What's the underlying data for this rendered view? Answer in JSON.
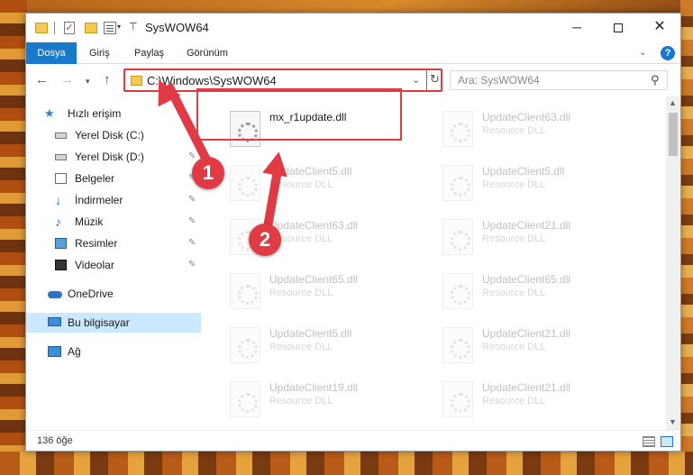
{
  "window": {
    "title": "SysWOW64",
    "min_label": "─",
    "close_label": "✕"
  },
  "quick_access": {
    "dropdown_glyph": "▾",
    "pin_glyph": "⊤"
  },
  "ribbon": {
    "tabs": [
      {
        "label": "Dosya"
      },
      {
        "label": "Giriş"
      },
      {
        "label": "Paylaş"
      },
      {
        "label": "Görünüm"
      }
    ],
    "expand_glyph": "⌄",
    "help_glyph": "?"
  },
  "nav": {
    "back_glyph": "←",
    "forward_glyph": "→",
    "recent_glyph": "▾",
    "up_glyph": "↑",
    "address": "C:\\Windows\\SysWOW64",
    "address_chevron": "⌄",
    "refresh_glyph": "↻",
    "search_placeholder": "Ara: SysWOW64",
    "search_glyph": "⚲"
  },
  "sidebar": {
    "items": [
      {
        "label": "Hızlı erişim",
        "icon": "star-icon"
      },
      {
        "label": "Yerel Disk (C:)",
        "icon": "drive-icon"
      },
      {
        "label": "Yerel Disk (D:)",
        "icon": "drive-icon",
        "pinned": true
      },
      {
        "label": "Belgeler",
        "icon": "documents-icon",
        "pinned": true
      },
      {
        "label": "İndirmeler",
        "icon": "download-icon",
        "pinned": true
      },
      {
        "label": "Müzik",
        "icon": "music-icon",
        "pinned": true
      },
      {
        "label": "Resimler",
        "icon": "pictures-icon",
        "pinned": true
      },
      {
        "label": "Videolar",
        "icon": "videos-icon",
        "pinned": true
      },
      {
        "label": "OneDrive",
        "icon": "cloud-icon"
      },
      {
        "label": "Bu bilgisayar",
        "icon": "computer-icon",
        "selected": true
      },
      {
        "label": "Ağ",
        "icon": "network-icon"
      }
    ],
    "pin_glyph": "✎"
  },
  "files": {
    "highlighted": {
      "name": "mx_r1update.dll",
      "desc": ""
    },
    "items": [
      {
        "name": "UpdateClient63.dll",
        "desc": "Resource DLL"
      },
      {
        "name": "UpdateClient5.dll",
        "desc": "Resource DLL"
      },
      {
        "name": "UpdateClient5.dll",
        "desc": "Resource DLL"
      },
      {
        "name": "UpdateClient63.dll",
        "desc": "Resource DLL"
      },
      {
        "name": "UpdateClient21.dll",
        "desc": "Resource DLL"
      },
      {
        "name": "UpdateClient65.dll",
        "desc": "Resource DLL"
      },
      {
        "name": "UpdateClient65.dll",
        "desc": "Resource DLL"
      },
      {
        "name": "UpdateClient5.dll",
        "desc": "Resource DLL"
      },
      {
        "name": "UpdateClient21.dll",
        "desc": "Resource DLL"
      },
      {
        "name": "UpdateClient19.dll",
        "desc": "Resource DLL"
      },
      {
        "name": "UpdateClient21.dll",
        "desc": "Resource DLL"
      }
    ]
  },
  "scrollbar": {
    "up_glyph": "▲",
    "down_glyph": "▼"
  },
  "status": {
    "count": "136 öğe"
  },
  "annotations": {
    "badge1": "1",
    "badge2": "2"
  },
  "colors": {
    "accent": "#1979ca",
    "highlight_red": "#e03b44",
    "selection": "#cce8ff"
  }
}
